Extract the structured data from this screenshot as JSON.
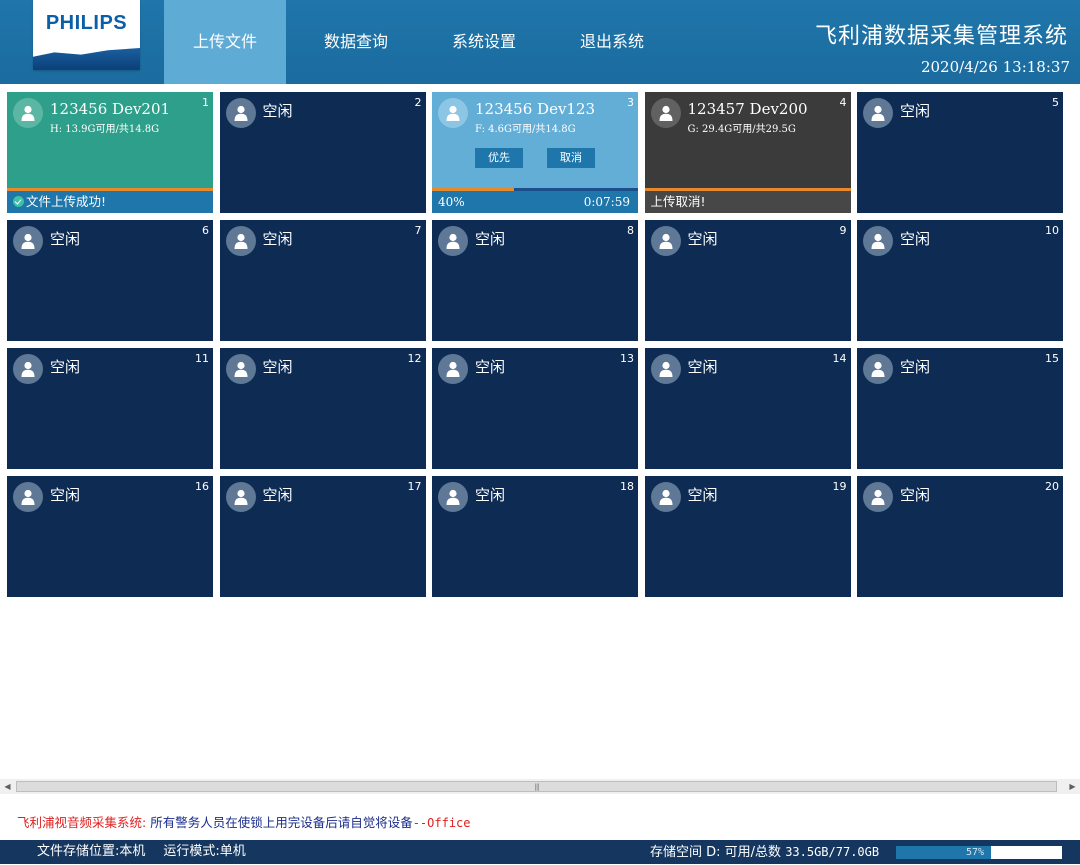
{
  "header": {
    "logo": "PHILIPS",
    "nav": [
      {
        "label": "上传文件",
        "active": true
      },
      {
        "label": "数据查询",
        "active": false
      },
      {
        "label": "系统设置",
        "active": false
      },
      {
        "label": "退出系统",
        "active": false
      }
    ],
    "title": "飞利浦数据采集管理系统",
    "datetime": "2020/4/26 13:18:37"
  },
  "slots": [
    {
      "num": "1",
      "state": "done",
      "owner": "123456",
      "device": "Dev201",
      "space": "H: 13.9G可用/共14.8G",
      "status": "文件上传成功!"
    },
    {
      "num": "2",
      "state": "idle",
      "label": "空闲"
    },
    {
      "num": "3",
      "state": "uploading",
      "owner": "123456",
      "device": "Dev123",
      "space": "F: 4.6G可用/共14.8G",
      "priority_label": "优先",
      "cancel_label": "取消",
      "progress": 0.4,
      "progress_label": "40%",
      "time_left": "0:07:59"
    },
    {
      "num": "4",
      "state": "cancelled",
      "owner": "123457",
      "device": "Dev200",
      "space": "G: 29.4G可用/共29.5G",
      "status": "上传取消!"
    },
    {
      "num": "5",
      "state": "idle",
      "label": "空闲"
    },
    {
      "num": "6",
      "state": "idle",
      "label": "空闲"
    },
    {
      "num": "7",
      "state": "idle",
      "label": "空闲"
    },
    {
      "num": "8",
      "state": "idle",
      "label": "空闲"
    },
    {
      "num": "9",
      "state": "idle",
      "label": "空闲"
    },
    {
      "num": "10",
      "state": "idle",
      "label": "空闲"
    },
    {
      "num": "11",
      "state": "idle",
      "label": "空闲"
    },
    {
      "num": "12",
      "state": "idle",
      "label": "空闲"
    },
    {
      "num": "13",
      "state": "idle",
      "label": "空闲"
    },
    {
      "num": "14",
      "state": "idle",
      "label": "空闲"
    },
    {
      "num": "15",
      "state": "idle",
      "label": "空闲"
    },
    {
      "num": "16",
      "state": "idle",
      "label": "空闲"
    },
    {
      "num": "17",
      "state": "idle",
      "label": "空闲"
    },
    {
      "num": "18",
      "state": "idle",
      "label": "空闲"
    },
    {
      "num": "19",
      "state": "idle",
      "label": "空闲"
    },
    {
      "num": "20",
      "state": "idle",
      "label": "空闲"
    }
  ],
  "notice": {
    "prefix": "飞利浦视音频采集系统:",
    "message": " 所有警务人员在使锁上用完设备后请自觉将设备",
    "suffix": "--Office"
  },
  "footer": {
    "storage_location": "文件存储位置:本机",
    "run_mode": "运行模式:单机",
    "storage_label": "存储空间 D: 可用/总数",
    "storage_value": "33.5GB/77.0GB",
    "storage_fraction": 0.57,
    "storage_percent": "57%"
  },
  "colors": {
    "header_bg": "#1f76aa",
    "nav_active": "#5eabd6",
    "slot_idle": "#0e2b53",
    "slot_done": "#2e9f8a",
    "slot_uploading": "#62aed6",
    "slot_cancelled": "#3b3b3b",
    "accent_orange": "#e8892b",
    "footer_bg": "#15375f"
  },
  "icons": {
    "slot_avatar": "user-icon",
    "success": "check-circle-icon",
    "scroll_left": "arrow-left-icon",
    "scroll_right": "arrow-right-icon"
  }
}
